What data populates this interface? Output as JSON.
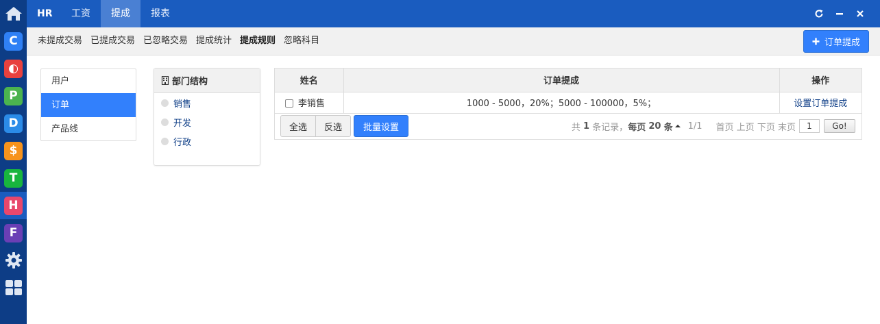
{
  "dock": {
    "apps": [
      {
        "letter": "C",
        "color": "#2f80f5",
        "icon": "c-app-icon"
      },
      {
        "letter": "◐",
        "color": "#e8413e",
        "icon": "o-app-icon"
      },
      {
        "letter": "P",
        "color": "#4bb34f",
        "icon": "p-app-icon"
      },
      {
        "letter": "D",
        "color": "#2b8be8",
        "icon": "d-app-icon"
      },
      {
        "letter": "$",
        "color": "#f7931c",
        "icon": "s-app-icon"
      },
      {
        "letter": "T",
        "color": "#18b53e",
        "icon": "t-app-icon"
      },
      {
        "letter": "H",
        "color": "#e8476c",
        "icon": "h-app-icon"
      },
      {
        "letter": "F",
        "color": "#6a3fb5",
        "icon": "f-app-icon"
      }
    ]
  },
  "topbar": {
    "brand": "HR",
    "tabs": [
      {
        "label": "工资"
      },
      {
        "label": "提成"
      },
      {
        "label": "报表"
      }
    ]
  },
  "subnav": {
    "items": [
      {
        "label": "未提成交易"
      },
      {
        "label": "已提成交易"
      },
      {
        "label": "已忽略交易"
      },
      {
        "label": "提成统计"
      },
      {
        "label": "提成规则"
      },
      {
        "label": "忽略科目"
      }
    ],
    "add_button": "订单提成"
  },
  "sidemenu": {
    "items": [
      {
        "label": "用户"
      },
      {
        "label": "订单"
      },
      {
        "label": "产品线"
      }
    ]
  },
  "dept": {
    "title": "部门结构",
    "items": [
      {
        "label": "销售"
      },
      {
        "label": "开发"
      },
      {
        "label": "行政"
      }
    ]
  },
  "grid": {
    "columns": [
      "姓名",
      "订单提成",
      "操作"
    ],
    "rows": [
      {
        "name": "李销售",
        "rule": "1000 - 5000，20%；5000 - 100000，5%；",
        "action": "设置订单提成"
      }
    ],
    "buttons": {
      "select_all": "全选",
      "invert": "反选",
      "batch": "批量设置"
    },
    "pager": {
      "total_prefix": "共",
      "total": "1",
      "total_suffix": "条记录，",
      "per_page_prefix": "每页",
      "per_page": "20",
      "per_page_suffix": "条",
      "page": "1/1",
      "first": "首页",
      "prev": "上页",
      "next": "下页",
      "last": "末页",
      "input": "1",
      "go": "Go!"
    }
  },
  "colors": {
    "accent": "#3280fc",
    "topbar": "#1a5cbf",
    "dock": "#0d3d86"
  }
}
